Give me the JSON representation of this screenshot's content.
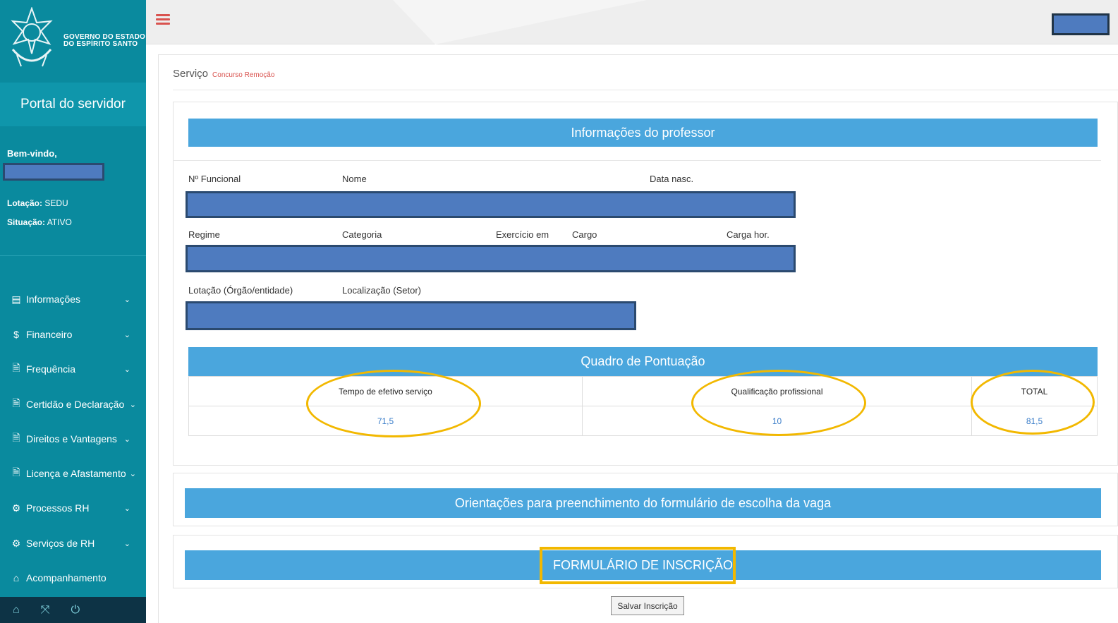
{
  "brand": {
    "line1": "GOVERNO DO ESTADO",
    "line2": "DO ESPÍRITO SANTO"
  },
  "sidebar": {
    "portal_title": "Portal do servidor",
    "welcome": "Bem-vindo,",
    "lotacao_label": "Lotação:",
    "lotacao_value": "SEDU",
    "situacao_label": "Situação:",
    "situacao_value": "ATIVO",
    "items": [
      {
        "label": "Informações",
        "icon": "id-card-icon",
        "glyph": "▤"
      },
      {
        "label": "Financeiro",
        "icon": "dollar-icon",
        "glyph": "$"
      },
      {
        "label": "Frequência",
        "icon": "document-icon",
        "glyph": "🗎"
      },
      {
        "label": "Certidão e Declaração",
        "icon": "document-icon",
        "glyph": "🗎"
      },
      {
        "label": "Direitos e Vantagens",
        "icon": "document-icon",
        "glyph": "🗎"
      },
      {
        "label": "Licença e Afastamento",
        "icon": "document-icon",
        "glyph": "🗎"
      },
      {
        "label": "Processos RH",
        "icon": "gears-icon",
        "glyph": "⚙"
      },
      {
        "label": "Serviços de RH",
        "icon": "gears-icon",
        "glyph": "⚙"
      },
      {
        "label": "Acompanhamento",
        "icon": "home-icon",
        "glyph": "⌂"
      }
    ],
    "chevron": "⌄"
  },
  "breadcrumb": {
    "title": "Serviço",
    "subtitle": "Concurso Remoção"
  },
  "professor": {
    "heading": "Informações do professor",
    "row1_labels": [
      "Nº Funcional",
      "Nome",
      "Data nasc."
    ],
    "row2_labels": [
      "Regime",
      "Categoria",
      "Exercício em",
      "Cargo",
      "Carga hor."
    ],
    "row3_labels": [
      "Lotação (Órgão/entidade)",
      "Localização (Setor)"
    ]
  },
  "score": {
    "heading": "Quadro de Pontuação",
    "headers": [
      "Tempo de efetivo serviço",
      "Qualificação profissional",
      "TOTAL"
    ],
    "values": [
      "71,5",
      "10",
      "81,5"
    ]
  },
  "orientacoes": {
    "heading": "Orientações para preenchimento do formulário de escolha da vaga"
  },
  "formulario": {
    "heading": "FORMULÁRIO DE INSCRIÇÃO"
  },
  "actions": {
    "save_label": "Salvar Inscrição"
  },
  "colors": {
    "sidebar": "#0a8a9e",
    "bar": "#4aa6dd",
    "highlight": "#f2b800",
    "redaction": "#4e7bbf"
  }
}
